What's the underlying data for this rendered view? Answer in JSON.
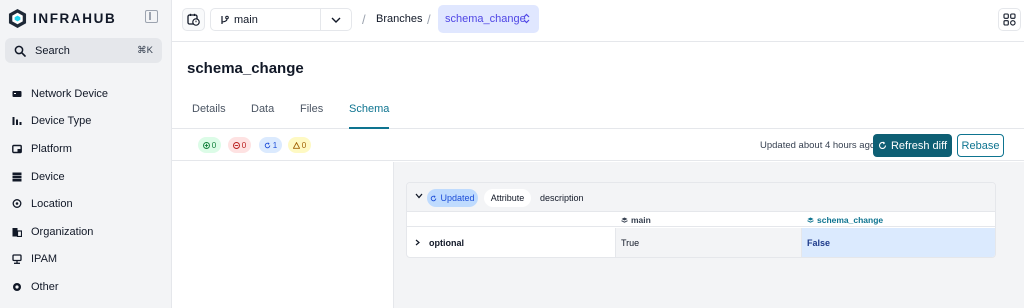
{
  "sidebar": {
    "logo_text": "INFRAHUB",
    "search": {
      "label": "Search",
      "shortcut": "⌘K"
    },
    "items": [
      {
        "label": "Network Device",
        "icon": "server-icon"
      },
      {
        "label": "Device Type",
        "icon": "bar-chart-icon"
      },
      {
        "label": "Platform",
        "icon": "platform-icon"
      },
      {
        "label": "Device",
        "icon": "device-icon"
      },
      {
        "label": "Location",
        "icon": "location-pin-icon"
      },
      {
        "label": "Organization",
        "icon": "organization-icon"
      },
      {
        "label": "IPAM",
        "icon": "ipam-icon"
      },
      {
        "label": "Other",
        "icon": "other-icon"
      }
    ]
  },
  "header": {
    "branch": "main",
    "breadcrumb": "Branches",
    "current_branch": "schema_change"
  },
  "page": {
    "title": "schema_change",
    "tabs": [
      "Details",
      "Data",
      "Files",
      "Schema"
    ],
    "active_tab": "Schema"
  },
  "toolbar": {
    "badges": {
      "added": "0",
      "removed": "0",
      "updated": "1",
      "conflicts": "0"
    },
    "updated_text": "Updated about 4 hours ago",
    "refresh_label": "Refresh diff",
    "rebase_label": "Rebase"
  },
  "diff": {
    "status": "Updated",
    "kind": "Attribute",
    "attribute_name": "description",
    "columns": {
      "main": "main",
      "schema": "schema_change"
    },
    "row": {
      "name": "optional",
      "main_value": "True",
      "schema_value": "False"
    }
  },
  "colors": {
    "accent": "#0e7490",
    "primary_button": "#0e5f74",
    "branch_highlight": "#e0e7ff",
    "updated_blue": "#dbeafe"
  }
}
